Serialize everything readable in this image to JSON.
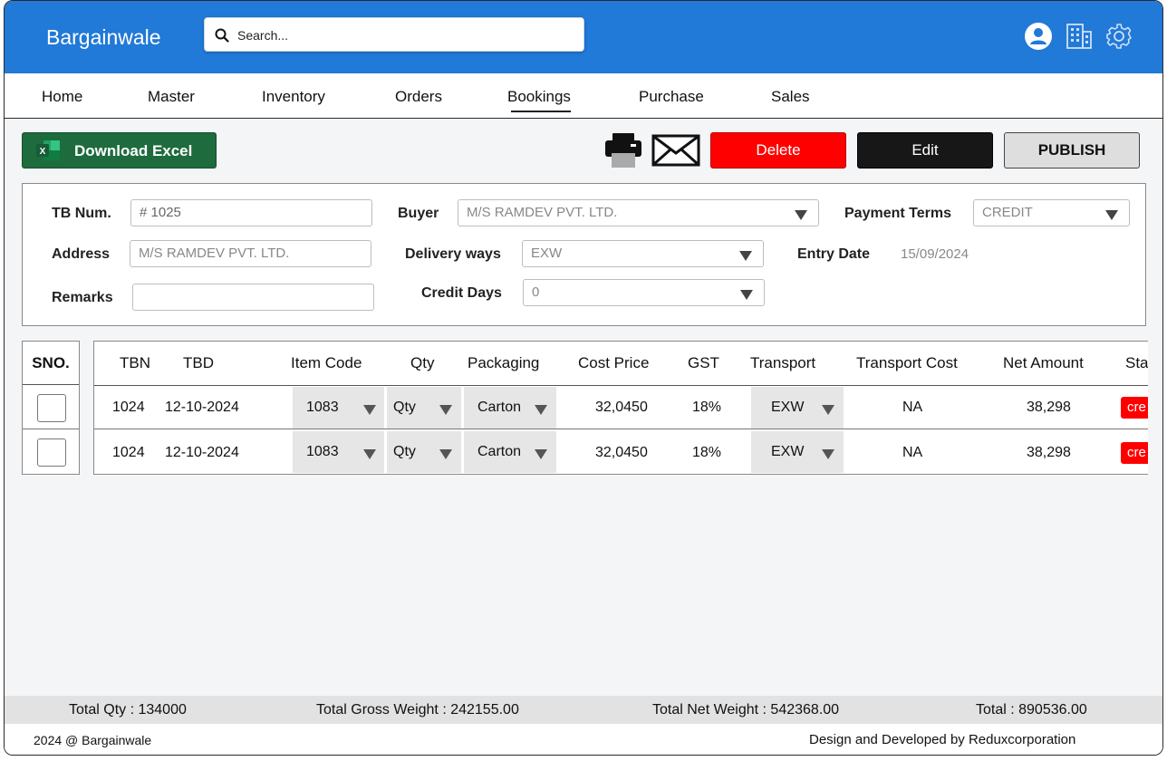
{
  "app": {
    "brand": "Bargainwale",
    "search_placeholder": "Search..."
  },
  "header_icons": [
    "user-icon",
    "building-icon",
    "gear-icon"
  ],
  "nav": {
    "items": [
      "Home",
      "Master",
      "Inventory",
      "Orders",
      "Bookings",
      "Purchase",
      "Sales"
    ],
    "active": "Bookings"
  },
  "toolbar": {
    "excel_label": "Download Excel",
    "delete_label": "Delete",
    "edit_label": "Edit",
    "publish_label": "PUBLISH",
    "colors": {
      "excel": "#1e6b3d",
      "delete": "#ff0000",
      "edit": "#171717",
      "publish": "#dedede"
    }
  },
  "form": {
    "tb_num": {
      "label": "TB Num.",
      "value": "# 1025"
    },
    "buyer": {
      "label": "Buyer",
      "value": "M/S RAMDEV PVT. LTD."
    },
    "payment_terms": {
      "label": "Payment Terms",
      "value": "CREDIT"
    },
    "address": {
      "label": "Address",
      "value": "M/S RAMDEV PVT. LTD."
    },
    "delivery_ways": {
      "label": "Delivery ways",
      "value": "EXW"
    },
    "entry_date": {
      "label": "Entry Date",
      "value": "15/09/2024"
    },
    "remarks": {
      "label": "Remarks",
      "value": ""
    },
    "credit_days": {
      "label": "Credit Days",
      "value": "0"
    }
  },
  "table": {
    "sno_header": "SNO.",
    "headers": {
      "tbn": "TBN",
      "tbd": "TBD",
      "item_code": "Item Code",
      "qty": "Qty",
      "packaging": "Packaging",
      "cost_price": "Cost Price",
      "gst": "GST",
      "transport": "Transport",
      "transport_cost": "Transport Cost",
      "net_amount": "Net Amount",
      "status": "Sta"
    },
    "rows": [
      {
        "tbn": "1024",
        "tbd": "12-10-2024",
        "item_code": "1083",
        "qty": "Qty",
        "packaging": "Carton",
        "cost_price": "32,0450",
        "gst": "18%",
        "transport": "EXW",
        "transport_cost": "NA",
        "net_amount": "38,298",
        "status": "cre"
      },
      {
        "tbn": "1024",
        "tbd": "12-10-2024",
        "item_code": "1083",
        "qty": "Qty",
        "packaging": "Carton",
        "cost_price": "32,0450",
        "gst": "18%",
        "transport": "EXW",
        "transport_cost": "NA",
        "net_amount": "38,298",
        "status": "cre"
      }
    ]
  },
  "totals": {
    "qty": "Total Qty : 134000",
    "gross_weight": "Total Gross Weight : 242155.00",
    "net_weight": "Total Net Weight : 542368.00",
    "total": "Total : 890536.00"
  },
  "footer": {
    "copyright": "2024 @ Bargainwale",
    "credit": "Design and Developed by Reduxcorporation"
  }
}
